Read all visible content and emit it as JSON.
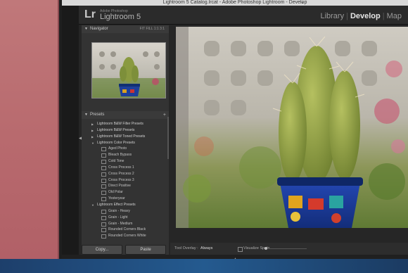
{
  "window": {
    "title": "Lightroom 5 Catalog.lrcat - Adobe Photoshop Lightroom - Develop"
  },
  "brand": {
    "logo": "Lr",
    "small": "Adobe Photoshop",
    "name": "Lightroom 5"
  },
  "modules": [
    {
      "label": "Library",
      "active": false
    },
    {
      "label": "Develop",
      "active": true
    },
    {
      "label": "Map",
      "active": false
    }
  ],
  "navigator": {
    "title": "Navigator",
    "options": [
      "FIT",
      "FILL",
      "1:1",
      "3:1"
    ]
  },
  "presets": {
    "title": "Presets",
    "items": [
      {
        "type": "folder",
        "label": "Lightroom B&W Filter Presets",
        "expanded": false
      },
      {
        "type": "folder",
        "label": "Lightroom B&W Presets",
        "expanded": false
      },
      {
        "type": "folder",
        "label": "Lightroom B&W Toned Presets",
        "expanded": false
      },
      {
        "type": "folder",
        "label": "Lightroom Color Presets",
        "expanded": true
      },
      {
        "type": "item",
        "label": "Aged Photo"
      },
      {
        "type": "item",
        "label": "Bleach Bypass"
      },
      {
        "type": "item",
        "label": "Cold Tone"
      },
      {
        "type": "item",
        "label": "Cross Process 1"
      },
      {
        "type": "item",
        "label": "Cross Process 2"
      },
      {
        "type": "item",
        "label": "Cross Process 3"
      },
      {
        "type": "item",
        "label": "Direct Positive"
      },
      {
        "type": "item",
        "label": "Old Polar"
      },
      {
        "type": "item",
        "label": "Yesteryear"
      },
      {
        "type": "folder",
        "label": "Lightroom Effect Presets",
        "expanded": true
      },
      {
        "type": "item",
        "label": "Grain - Heavy"
      },
      {
        "type": "item",
        "label": "Grain - Light"
      },
      {
        "type": "item",
        "label": "Grain - Medium"
      },
      {
        "type": "item",
        "label": "Rounded Corners Black"
      },
      {
        "type": "item",
        "label": "Rounded Corners White"
      }
    ]
  },
  "buttons": {
    "copy": "Copy...",
    "paste": "Paste"
  },
  "toolbar": {
    "overlay_label": "Tool Overlay :",
    "overlay_value": "Always",
    "visualize_label": "Visualize Spots"
  },
  "colors": {
    "desktop": "#b86a6e",
    "panel": "#333333",
    "dock": "#245a8f"
  }
}
